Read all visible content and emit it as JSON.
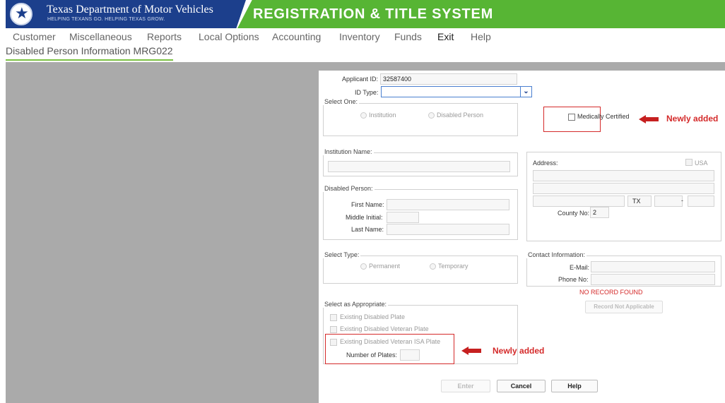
{
  "header": {
    "logo_title": "Texas Department of Motor Vehicles",
    "logo_subtitle": "HELPING TEXANS GO. HELPING TEXAS GROW.",
    "system_title": "REGISTRATION & TITLE SYSTEM",
    "brand_blue": "#1c3f8c",
    "brand_green": "#57b534"
  },
  "menu": [
    "Customer",
    "Miscellaneous",
    "Reports",
    "Local Options",
    "Accounting",
    "Inventory",
    "Funds",
    "Exit",
    "Help"
  ],
  "module": {
    "title": "Disabled Person Information MRG022"
  },
  "form": {
    "applicant_id_label": "Applicant ID:",
    "applicant_id_value": "32587400",
    "id_type_label": "ID Type:",
    "id_type_value": "",
    "select_one_legend": "Select One:",
    "institution_radio": "Institution",
    "disabled_person_radio": "Disabled Person",
    "medically_certified_label": "Medically Certified",
    "institution_name_legend": "Institution Name:",
    "disabled_person_legend": "Disabled Person:",
    "first_name_label": "First Name:",
    "middle_initial_label": "Middle Initial:",
    "last_name_label": "Last Name:",
    "address_label": "Address:",
    "usa_label": "USA",
    "state_value": "TX",
    "zip_dash": "-",
    "county_no_label": "County No:",
    "county_no_value": "2",
    "select_type_legend": "Select Type:",
    "permanent_radio": "Permanent",
    "temporary_radio": "Temporary",
    "contact_legend": "Contact Information:",
    "email_label": "E-Mail:",
    "phone_label": "Phone No:",
    "no_record": "NO RECORD FOUND",
    "record_not_applicable": "Record Not Applicable",
    "select_appropriate_legend": "Select as Appropriate:",
    "existing_disabled_plate": "Existing Disabled Plate",
    "existing_disabled_veteran_plate": "Existing Disabled Veteran Plate",
    "existing_disabled_veteran_isa_plate": "Existing Disabled Veteran ISA Plate",
    "number_of_plates_label": "Number of Plates:",
    "enter_button": "Enter",
    "cancel_button": "Cancel",
    "help_button": "Help"
  },
  "annotations": {
    "newly_added_1": "Newly added",
    "newly_added_2": "Newly added",
    "color": "#d42a2a"
  }
}
